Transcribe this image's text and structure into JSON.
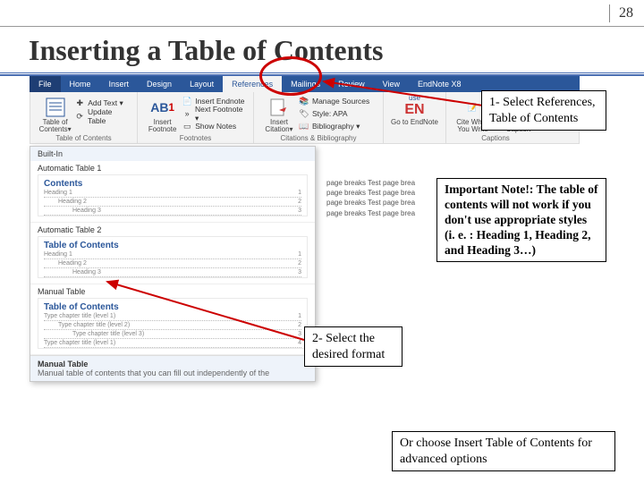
{
  "page_number": "28",
  "title": "Inserting a Table of Contents",
  "word": {
    "tabs": [
      "File",
      "Home",
      "Insert",
      "Design",
      "Layout",
      "References",
      "Mailings",
      "Review",
      "View",
      "EndNote X8"
    ],
    "active_tab_index": 5,
    "groups": {
      "toc": {
        "big": "Table of\nContents▾",
        "r1": "Add Text ▾",
        "r2": "Update Table",
        "label": "Table of Contents"
      },
      "footnotes": {
        "big": "AB¹",
        "biglbl": "Insert\nFootnote",
        "r1": "Insert Endnote",
        "r2": "Next Footnote ▾",
        "r3": "Show Notes",
        "label": "Footnotes"
      },
      "citations": {
        "biglbl": "Insert\nCitation▾",
        "r1": "Manage Sources",
        "r2": "Style: APA",
        "r3": "Bibliography ▾",
        "label": "Citations & Bibliography"
      },
      "en": {
        "r1": "use",
        "big": "EN",
        "r2": "Go to EndNote",
        "label": ""
      },
      "captions": {
        "c1": "Cite While\nYou Write",
        "c2": "Insert\nCaption",
        "label": "Captions"
      }
    }
  },
  "gallery": {
    "header": "Built-In",
    "items": [
      {
        "title": "Automatic Table 1",
        "heading": "Contents",
        "l1": "Heading 1",
        "l2": "Heading 2",
        "l3": "Heading 3"
      },
      {
        "title": "Automatic Table 2",
        "heading": "Table of Contents",
        "l1": "Heading 1",
        "l2": "Heading 2",
        "l3": "Heading 3"
      },
      {
        "title": "Manual Table",
        "heading": "Table of Contents",
        "l1": "Type chapter title (level 1)",
        "l2": "Type chapter title (level 2)",
        "l3": "Type chapter title (level 3)",
        "l1b": "Type chapter title (level 1)"
      }
    ],
    "footer": {
      "title": "Manual Table",
      "desc": "Manual table of contents that you can fill out independently of the"
    }
  },
  "doc_lines": [
    "page breaks Test page brea",
    "page breaks Test page brea",
    "page breaks Test page brea",
    "page breaks Test page brea"
  ],
  "callouts": {
    "c1": "1- Select References, Table of Contents",
    "note": "Important Note!: The table of contents will not work if you don't use appropriate styles (i. e. : Heading 1, Heading 2, and Heading 3…)",
    "c2": "2- Select the desired format",
    "c3": "Or choose Insert Table of Contents for advanced options"
  }
}
